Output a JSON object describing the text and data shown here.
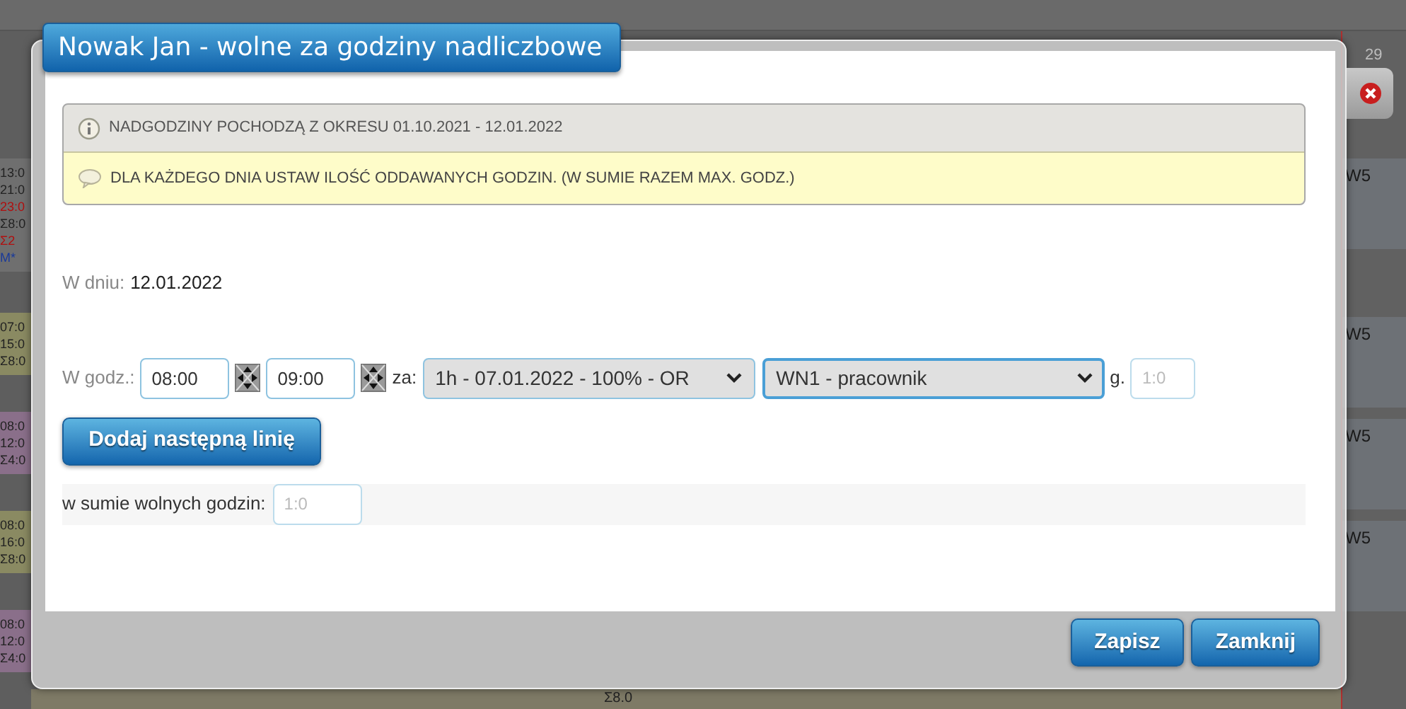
{
  "background": {
    "left_groups": [
      [
        {
          "text": "13:0",
          "color": "#222222"
        },
        {
          "text": "21:0",
          "color": "#222222"
        },
        {
          "text": "23:0",
          "color": "#b01010"
        },
        {
          "text": "Σ8:0",
          "color": "#222222"
        },
        {
          "text": "Σ2",
          "color": "#b01010"
        },
        {
          "text": "M*",
          "color": "#1a3a9a"
        }
      ],
      [
        {
          "text": "07:0",
          "color": "#222222"
        },
        {
          "text": "15:0",
          "color": "#222222"
        },
        {
          "text": "Σ8:0",
          "color": "#222222"
        }
      ],
      [
        {
          "text": "08:0",
          "color": "#222222"
        },
        {
          "text": "12:0",
          "color": "#222222"
        },
        {
          "text": "Σ4:0",
          "color": "#222222"
        }
      ],
      [
        {
          "text": "08:0",
          "color": "#222222"
        },
        {
          "text": "16:0",
          "color": "#222222"
        },
        {
          "text": "Σ8:0",
          "color": "#222222"
        }
      ],
      [
        {
          "text": "08:0",
          "color": "#222222"
        },
        {
          "text": "12:0",
          "color": "#222222"
        },
        {
          "text": "Σ4:0",
          "color": "#222222"
        }
      ]
    ],
    "right_header": "29",
    "right_entries": [
      "W5",
      "W5",
      "W5",
      "W5"
    ],
    "bottom_text": "Σ8.0"
  },
  "dialog": {
    "title": "Nowak Jan - wolne za godziny nadliczbowe",
    "info": "NADGODZINY POCHODZĄ Z OKRESU 01.10.2021 - 12.01.2022",
    "hint": "DLA KAŻDEGO DNIA USTAW ILOŚĆ ODDAWANYCH GODZIN. (W SUMIE RAZEM MAX. GODZ.)",
    "date_label": "W dniu:",
    "date_value": "12.01.2022",
    "hours_label": "W godz.:",
    "from": "08:00",
    "to": "09:00",
    "for_label": "za:",
    "source_select": "1h - 07.01.2022 - 100% - OR",
    "type_select": "WN1 - pracownik",
    "hours_unit": "g.",
    "hours_value": "1:0",
    "add_button": "Dodaj następną linię",
    "sum_label": "w sumie wolnych godzin:",
    "sum_value": "1:0",
    "buttons": [
      "Zapisz",
      "Zamknij"
    ]
  }
}
